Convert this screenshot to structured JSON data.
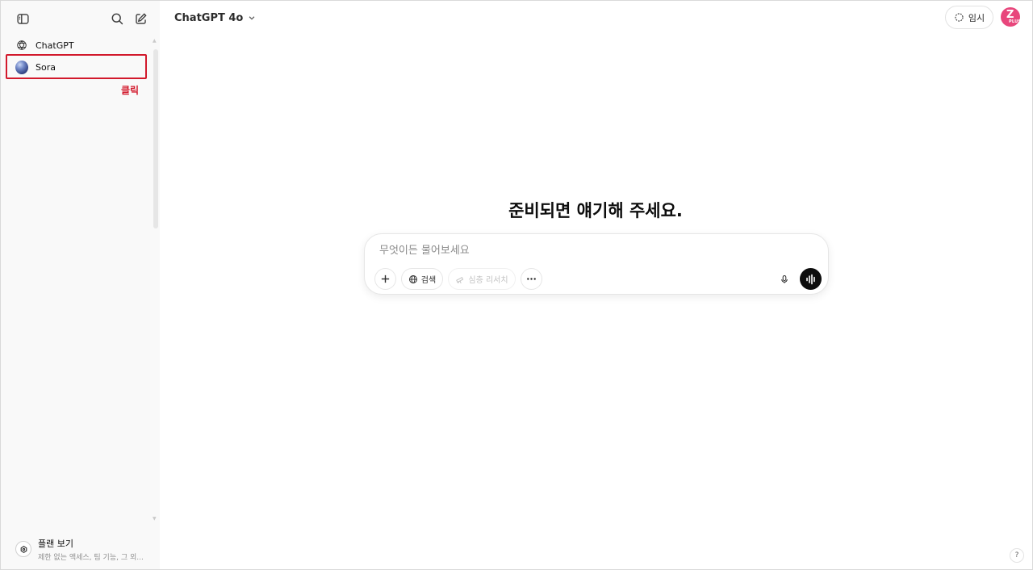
{
  "sidebar": {
    "items": [
      {
        "label": "ChatGPT",
        "icon": "openai-logo-icon"
      },
      {
        "label": "Sora",
        "icon": "sora-orb-icon"
      }
    ],
    "annotation_label": "클릭",
    "plan": {
      "title": "플랜 보기",
      "subtitle": "제한 없는 액세스, 팀 기능, 그 외..."
    }
  },
  "header": {
    "model_label": "ChatGPT 4o",
    "temporary_label": "임시",
    "avatar": {
      "letter": "Z",
      "badge": "PLUS",
      "color": "#e8467c"
    }
  },
  "main": {
    "heading": "준비되면 얘기해 주세요.",
    "composer": {
      "placeholder": "무엇이든 물어보세요",
      "search_label": "검색",
      "deep_research_label": "심층 리서치"
    }
  },
  "help": {
    "label": "?"
  },
  "colors": {
    "annotation": "#d2192c",
    "sidebar_bg": "#f9f9f9",
    "avatar": "#e8467c"
  }
}
